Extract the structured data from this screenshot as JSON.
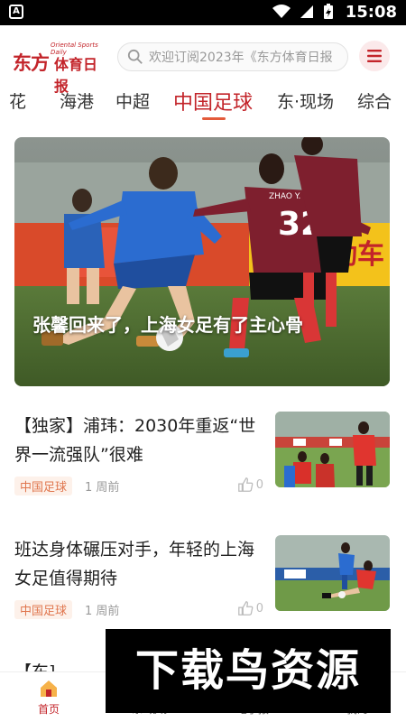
{
  "status": {
    "time": "15:08",
    "app_badge": "A"
  },
  "header": {
    "logo_main": "东方",
    "logo_cn": "体育日报",
    "logo_sub": "Oriental Sports Daily",
    "search_placeholder": "欢迎订阅2023年《东方体育日报"
  },
  "tabs": [
    {
      "label": "花"
    },
    {
      "label": "海港"
    },
    {
      "label": "中超"
    },
    {
      "label": "中国足球"
    },
    {
      "label": "东·现场"
    },
    {
      "label": "综合"
    }
  ],
  "active_tab": "中国足球",
  "hero": {
    "title": "张馨回来了，上海女足有了主心骨",
    "jersey_number": "32",
    "jersey_name": "ZHAO Y.",
    "board_text": "动车"
  },
  "articles": [
    {
      "title": "【独家】浦玮：2030年重返“世界一流强队”很难",
      "tag": "中国足球",
      "time": "1 周前",
      "likes": "0"
    },
    {
      "title": "班达身体碾压对手，年轻的上海女足值得期待",
      "tag": "中国足球",
      "time": "1 周前",
      "likes": "0"
    }
  ],
  "partial_article": "【东]",
  "bottom_nav": [
    {
      "label": "首页",
      "icon": "home-icon"
    },
    {
      "label": "东·现场",
      "icon": "live-icon"
    },
    {
      "label": "电子报",
      "icon": "paper-icon"
    },
    {
      "label": "我的",
      "icon": "profile-icon"
    }
  ],
  "watermark": "下载鸟资源",
  "colors": {
    "brand": "#c3242a",
    "tag": "#e0764e",
    "underline": "#e35a3a"
  }
}
